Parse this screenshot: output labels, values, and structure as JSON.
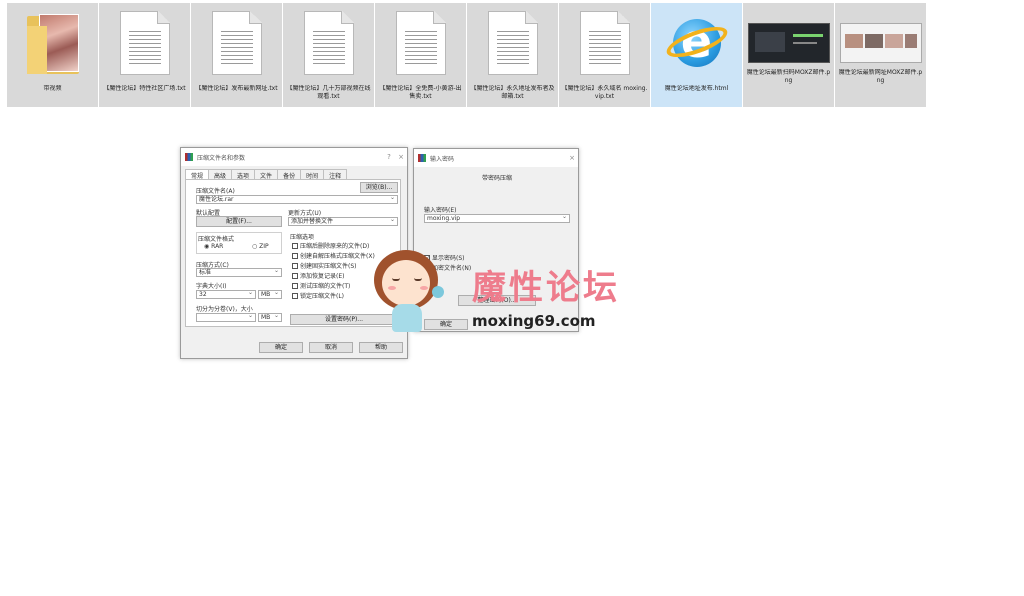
{
  "files": [
    {
      "name": "带视频",
      "kind": "folder"
    },
    {
      "name": "【魔性论坛】特性社区广场.txt",
      "kind": "txt"
    },
    {
      "name": "【魔性论坛】发布最新网址.txt",
      "kind": "txt"
    },
    {
      "name": "【魔性论坛】几十万部视频在线观看.txt",
      "kind": "txt"
    },
    {
      "name": "【魔性论坛】全免费-小黄游-出售卖.txt",
      "kind": "txt"
    },
    {
      "name": "【魔性论坛】永久地址发布者及邮箱.txt",
      "kind": "txt"
    },
    {
      "name": "【魔性论坛】永久域名 moxing.vip.txt",
      "kind": "txt"
    },
    {
      "name": "魔性论坛地址发布.html",
      "kind": "ie"
    },
    {
      "name": "魔性论坛最新扫码MOXZ邮件.png",
      "kind": "png-dark"
    },
    {
      "name": "魔性论坛最新网址MOXZ邮件.png",
      "kind": "png-light"
    }
  ],
  "archive_dialog": {
    "title": "压缩文件名和参数",
    "tabs": [
      "常规",
      "高级",
      "选项",
      "文件",
      "备份",
      "时间",
      "注释"
    ],
    "archive_name_label": "压缩文件名(A)",
    "archive_name_value": "魔性论坛.rar",
    "browse_button": "浏览(B)...",
    "default_profile_label": "默认配置",
    "profiles_button": "配置(F)...",
    "update_mode_label": "更新方式(U)",
    "update_mode_value": "添加并替换文件",
    "format_label": "压缩文件格式",
    "format_rar": "RAR",
    "format_zip": "ZIP",
    "method_label": "压缩方式(C)",
    "method_value": "标准",
    "dict_label": "字典大小(I)",
    "dict_value": "32",
    "dict_unit": "MB",
    "split_label": "切分为分卷(V)，大小",
    "split_unit": "MB",
    "options_label": "压缩选项",
    "options": [
      "压缩后删除原来的文件(D)",
      "创建自解压格式压缩文件(X)",
      "创建固实压缩文件(S)",
      "添加恢复记录(E)",
      "测试压缩的文件(T)",
      "锁定压缩文件(L)"
    ],
    "set_password_button": "设置密码(P)...",
    "ok_button": "确定",
    "cancel_button": "取消",
    "help_button": "帮助"
  },
  "password_dialog": {
    "title": "输入密码",
    "heading": "带密码压缩",
    "password_label": "输入密码(E)",
    "password_value": "moxing.vip",
    "show_password": "显示密码(S)",
    "encrypt_names": "加密文件名(N)",
    "organize_button": "整理密码(O)...",
    "ok_button": "确定"
  },
  "watermark": {
    "title": "魔性论坛",
    "url": "moxing69.com"
  }
}
